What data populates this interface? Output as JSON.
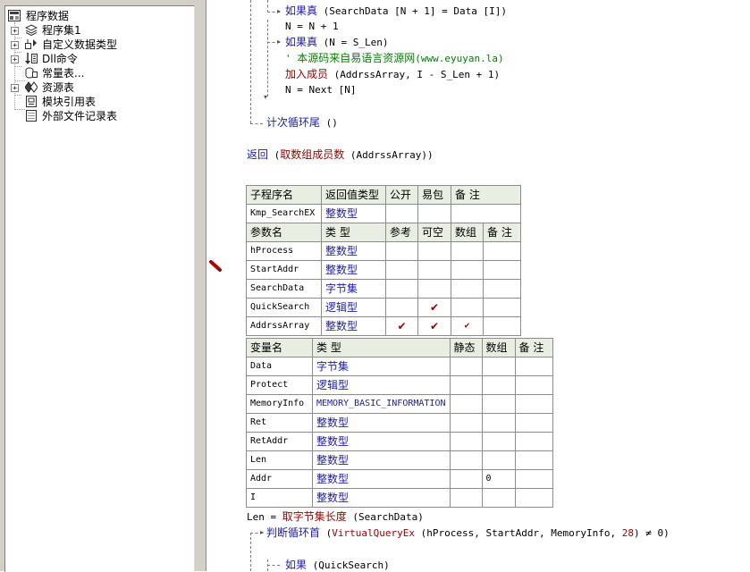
{
  "tree": {
    "root": "程序数据",
    "items": [
      {
        "label": "程序集1",
        "expand": "+"
      },
      {
        "label": "自定义数据类型",
        "expand": "+"
      },
      {
        "label": "Dll命令",
        "expand": "+"
      },
      {
        "label": "常量表...",
        "expand": ""
      },
      {
        "label": "资源表",
        "expand": "+"
      },
      {
        "label": "模块引用表",
        "expand": ""
      },
      {
        "label": "外部文件记录表",
        "expand": ""
      }
    ]
  },
  "code_top": {
    "l1_kw": "如果真",
    "l1_rest": " (SearchData [N + 1] = Data [I])",
    "l2": "N = N + 1",
    "l3_kw": "如果真",
    "l3_rest": " (N = S_Len)",
    "l4_q": "' ",
    "l4_cn": "本源码来自易语言资源网",
    "l4_url": "(www.eyuyan.la)",
    "l5_cmd": "加入成员",
    "l5_rest": " (AddrssArray, I - S_Len + 1)",
    "l6": "N = Next [N]",
    "l7_kw": "计次循环尾",
    "l7_rest": " ()",
    "l8_kw": "返回",
    "l8_rest1": " (",
    "l8_cmd": "取数组成员数",
    "l8_rest2": " (AddrssArray))"
  },
  "sub_table": {
    "header": [
      "子程序名",
      "返回值类型",
      "公开",
      "易包",
      "备 注"
    ],
    "row": {
      "name": "Kmp_SearchEX",
      "type": "整数型",
      "public": "",
      "epkg": "",
      "note": ""
    }
  },
  "param_table": {
    "header": [
      "参数名",
      "类 型",
      "参考",
      "可空",
      "数组",
      "备 注"
    ],
    "rows": [
      {
        "name": "hProcess",
        "type": "整数型",
        "ref": "",
        "opt": "",
        "arr": "",
        "note": ""
      },
      {
        "name": "StartAddr",
        "type": "整数型",
        "ref": "",
        "opt": "",
        "arr": "",
        "note": ""
      },
      {
        "name": "SearchData",
        "type": "字节集",
        "ref": "",
        "opt": "",
        "arr": "",
        "note": ""
      },
      {
        "name": "QuickSearch",
        "type": "逻辑型",
        "ref": "",
        "opt": "✔",
        "arr": "",
        "note": ""
      },
      {
        "name": "AddrssArray",
        "type": "整数型",
        "ref": "✔",
        "opt": "✔",
        "arr": "✔",
        "note": ""
      }
    ]
  },
  "var_table": {
    "header": [
      "变量名",
      "类 型",
      "静态",
      "数组",
      "备 注"
    ],
    "rows": [
      {
        "name": "Data",
        "type": "字节集",
        "static": "",
        "arr": "",
        "note": ""
      },
      {
        "name": "Protect",
        "type": "逻辑型",
        "static": "",
        "arr": "",
        "note": ""
      },
      {
        "name": "MemoryInfo",
        "type": "MEMORY_BASIC_INFORMATION",
        "static": "",
        "arr": "",
        "note": ""
      },
      {
        "name": "Ret",
        "type": "整数型",
        "static": "",
        "arr": "",
        "note": ""
      },
      {
        "name": "RetAddr",
        "type": "整数型",
        "static": "",
        "arr": "",
        "note": ""
      },
      {
        "name": "Len",
        "type": "整数型",
        "static": "",
        "arr": "",
        "note": ""
      },
      {
        "name": "Addr",
        "type": "整数型",
        "static": "",
        "arr": "0",
        "note": ""
      },
      {
        "name": "I",
        "type": "整数型",
        "static": "",
        "arr": "",
        "note": ""
      }
    ]
  },
  "code_bottom": {
    "b1_lhs": "Len = ",
    "b1_cmd": "取字节集长度",
    "b1_rest": " (SearchData)",
    "b2_kw": "判断循环首",
    "b2_rest1": " (",
    "b2_cmd": "VirtualQueryEx",
    "b2_rest2": " (hProcess, StartAddr, MemoryInfo, ",
    "b2_num": "28",
    "b2_rest3": ") ≠ 0)",
    "b3_kw": "如果",
    "b3_rest": " (QuickSearch)"
  },
  "colors": {
    "keyword": "#1c1ca8",
    "command": "#9b0000",
    "comment": "#008000",
    "header_bg": "#e8efe2"
  }
}
